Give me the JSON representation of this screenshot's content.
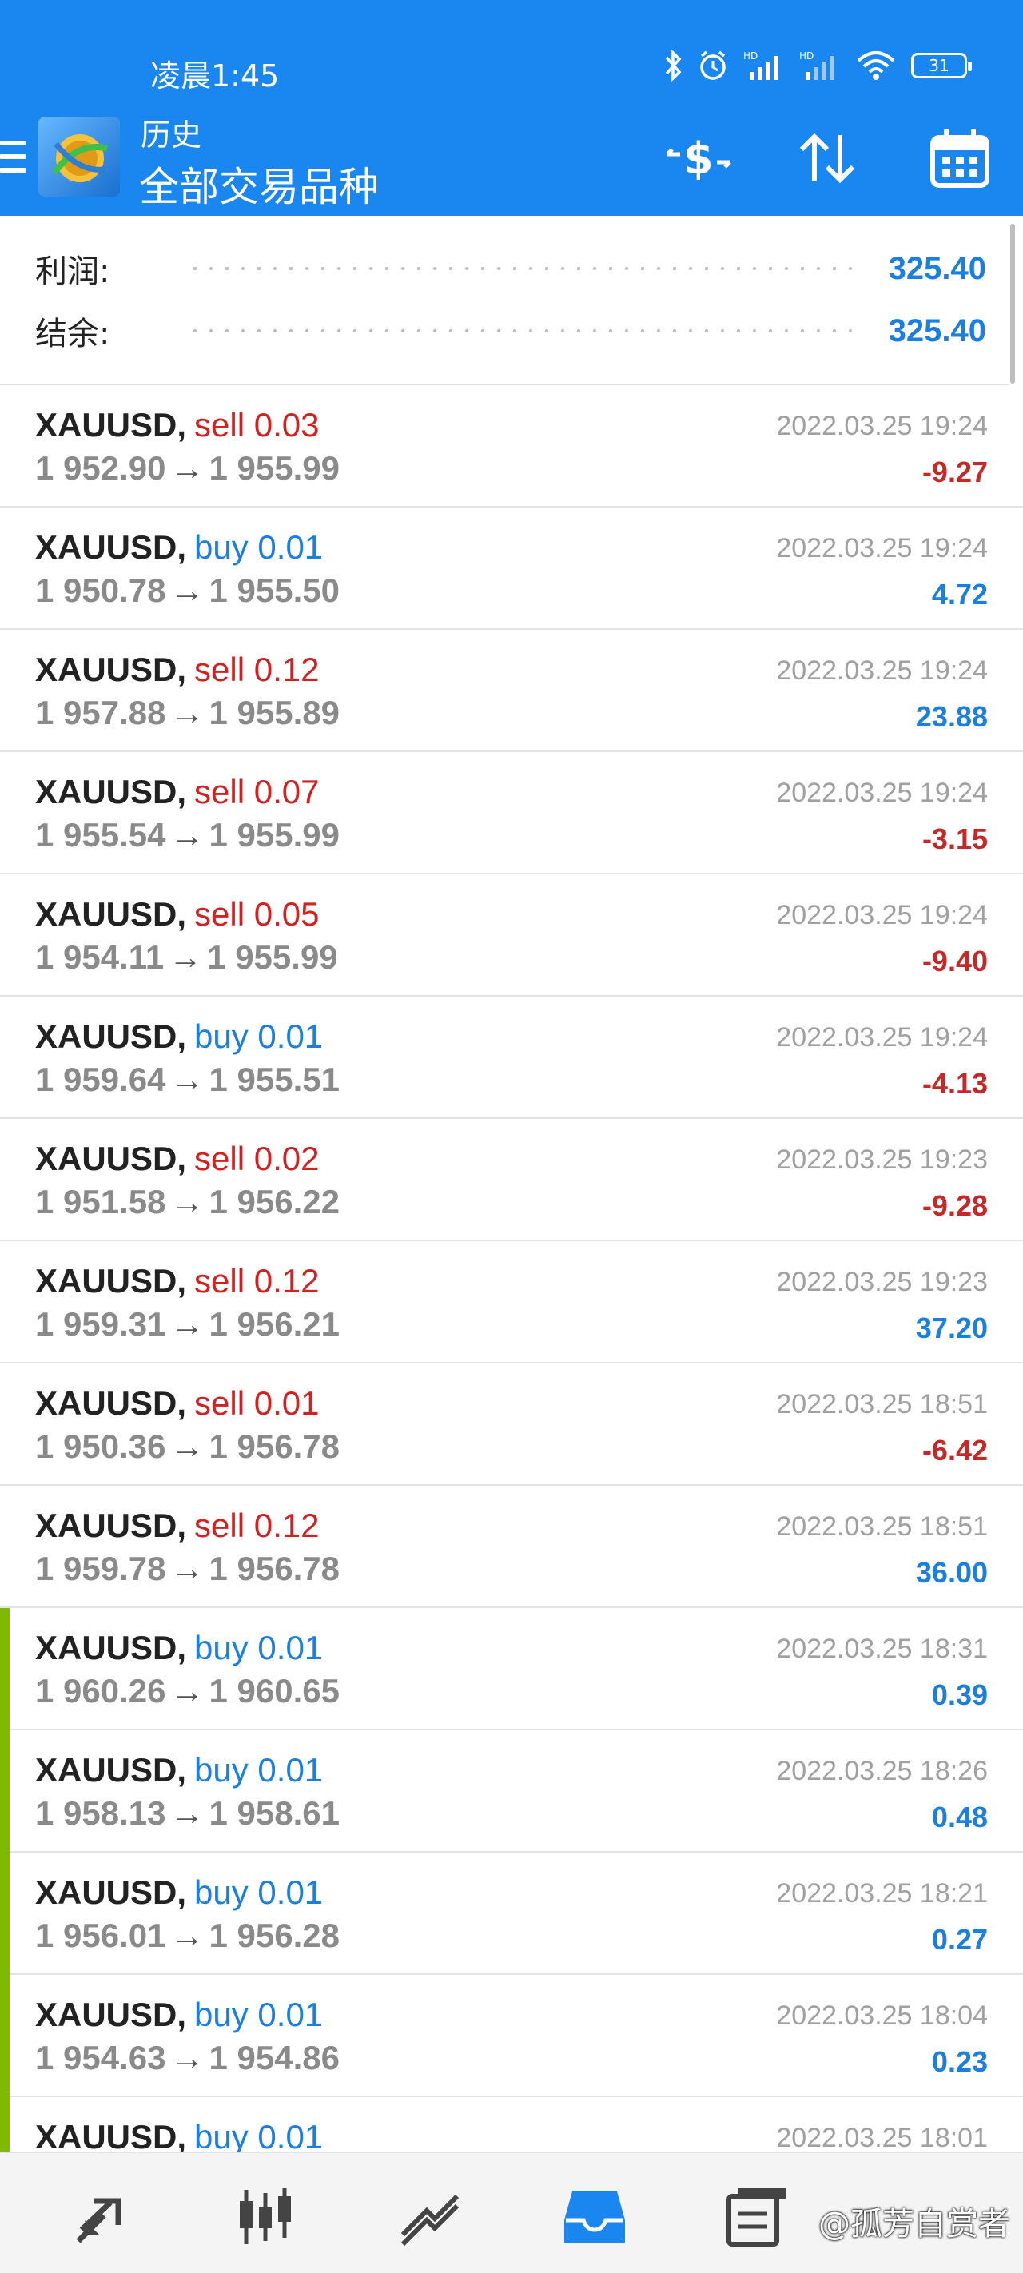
{
  "status_bar": {
    "time": "凌晨1:45",
    "battery": "31"
  },
  "header": {
    "title": "历史",
    "subtitle": "全部交易品种"
  },
  "summary": {
    "profit_label": "利润:",
    "profit_value": "325.40",
    "balance_label": "结余:",
    "balance_value": "325.40"
  },
  "trades": [
    {
      "symbol": "XAUUSD,",
      "side": "sell",
      "volume": "0.03",
      "open": "1 952.90",
      "close": "1 955.99",
      "time": "2022.03.25 19:24",
      "profit": "-9.27"
    },
    {
      "symbol": "XAUUSD,",
      "side": "buy",
      "volume": "0.01",
      "open": "1 950.78",
      "close": "1 955.50",
      "time": "2022.03.25 19:24",
      "profit": "4.72"
    },
    {
      "symbol": "XAUUSD,",
      "side": "sell",
      "volume": "0.12",
      "open": "1 957.88",
      "close": "1 955.89",
      "time": "2022.03.25 19:24",
      "profit": "23.88"
    },
    {
      "symbol": "XAUUSD,",
      "side": "sell",
      "volume": "0.07",
      "open": "1 955.54",
      "close": "1 955.99",
      "time": "2022.03.25 19:24",
      "profit": "-3.15"
    },
    {
      "symbol": "XAUUSD,",
      "side": "sell",
      "volume": "0.05",
      "open": "1 954.11",
      "close": "1 955.99",
      "time": "2022.03.25 19:24",
      "profit": "-9.40"
    },
    {
      "symbol": "XAUUSD,",
      "side": "buy",
      "volume": "0.01",
      "open": "1 959.64",
      "close": "1 955.51",
      "time": "2022.03.25 19:24",
      "profit": "-4.13"
    },
    {
      "symbol": "XAUUSD,",
      "side": "sell",
      "volume": "0.02",
      "open": "1 951.58",
      "close": "1 956.22",
      "time": "2022.03.25 19:23",
      "profit": "-9.28"
    },
    {
      "symbol": "XAUUSD,",
      "side": "sell",
      "volume": "0.12",
      "open": "1 959.31",
      "close": "1 956.21",
      "time": "2022.03.25 19:23",
      "profit": "37.20"
    },
    {
      "symbol": "XAUUSD,",
      "side": "sell",
      "volume": "0.01",
      "open": "1 950.36",
      "close": "1 956.78",
      "time": "2022.03.25 18:51",
      "profit": "-6.42"
    },
    {
      "symbol": "XAUUSD,",
      "side": "sell",
      "volume": "0.12",
      "open": "1 959.78",
      "close": "1 956.78",
      "time": "2022.03.25 18:51",
      "profit": "36.00"
    },
    {
      "symbol": "XAUUSD,",
      "side": "buy",
      "volume": "0.01",
      "open": "1 960.26",
      "close": "1 960.65",
      "time": "2022.03.25 18:31",
      "profit": "0.39",
      "marked": true
    },
    {
      "symbol": "XAUUSD,",
      "side": "buy",
      "volume": "0.01",
      "open": "1 958.13",
      "close": "1 958.61",
      "time": "2022.03.25 18:26",
      "profit": "0.48",
      "marked": true
    },
    {
      "symbol": "XAUUSD,",
      "side": "buy",
      "volume": "0.01",
      "open": "1 956.01",
      "close": "1 956.28",
      "time": "2022.03.25 18:21",
      "profit": "0.27",
      "marked": true
    },
    {
      "symbol": "XAUUSD,",
      "side": "buy",
      "volume": "0.01",
      "open": "1 954.63",
      "close": "1 954.86",
      "time": "2022.03.25 18:04",
      "profit": "0.23",
      "marked": true
    },
    {
      "symbol": "XAUUSD,",
      "side": "buy",
      "volume": "0.01",
      "open": "",
      "close": "",
      "time": "2022.03.25 18:01",
      "profit": "",
      "marked": true
    }
  ],
  "arrow_glyph": "→",
  "bottom_nav": {
    "items": [
      "quotes-icon",
      "chart-icon",
      "trade-icon",
      "history-icon",
      "messages-icon"
    ],
    "active": "history-icon"
  },
  "watermark": "@孤芳自赏者",
  "colors": {
    "header_bg": "#1a86f0",
    "sell": "#d32020",
    "buy": "#1a7fe0",
    "loss": "#c62828",
    "gain": "#1a7fe0",
    "closed_marker": "#7fba00"
  }
}
